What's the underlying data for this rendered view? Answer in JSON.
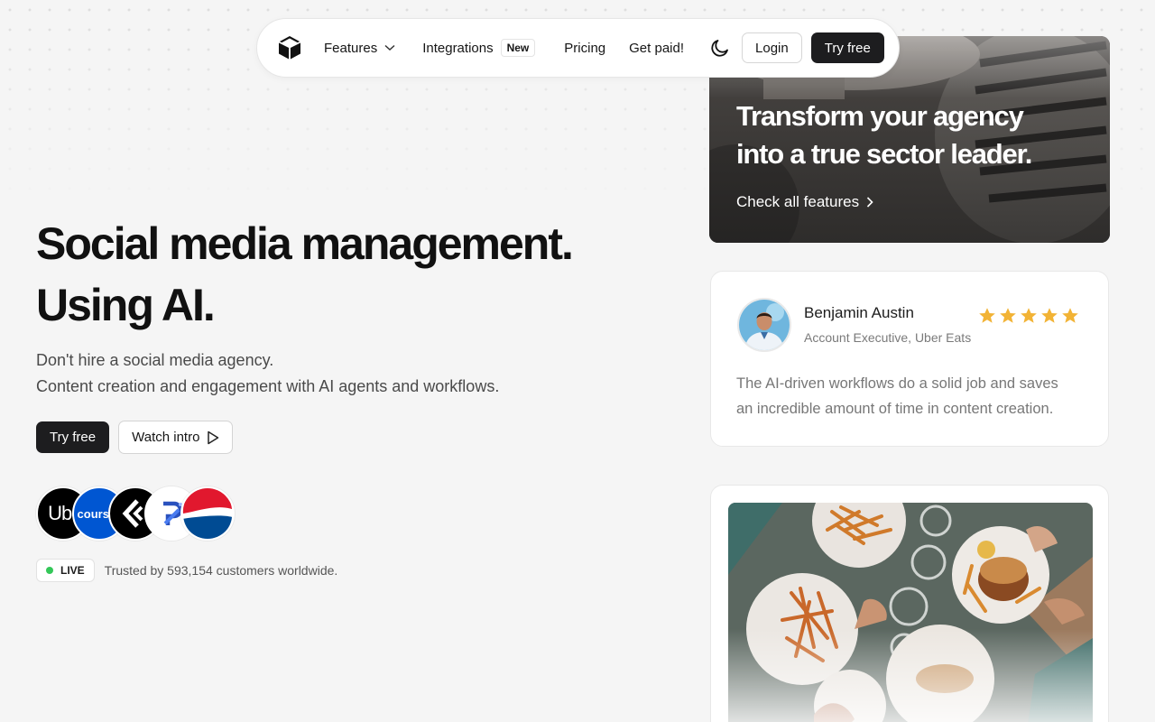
{
  "nav": {
    "logo_icon": "cube-icon",
    "links": [
      {
        "label": "Features",
        "has_dropdown": true
      },
      {
        "label": "Integrations",
        "badge": "New"
      },
      {
        "label": "Pricing"
      },
      {
        "label": "Get paid!"
      }
    ],
    "theme_icon": "moon-icon",
    "login_label": "Login",
    "try_label": "Try free"
  },
  "hero": {
    "title_line1": "Social media management.",
    "title_line2": "Using AI.",
    "sub_line1": "Don't hire a social media agency.",
    "sub_line2": "Content creation and engagement with AI agents and workflows.",
    "cta_primary": "Try free",
    "cta_secondary": "Watch intro",
    "customer_logos": [
      {
        "name": "Uber",
        "text": "Uber",
        "bg": "#000000",
        "fg": "#ffffff"
      },
      {
        "name": "Coursera",
        "text": "coursera",
        "bg": "#0056d2",
        "fg": "#ffffff"
      },
      {
        "name": "Logo 3",
        "text": "",
        "bg": "#000000",
        "fg": "#ffffff"
      },
      {
        "name": "Logo 4",
        "text": "",
        "bg": "#ffffff",
        "fg": "#2a52be"
      },
      {
        "name": "Pepsi",
        "text": "",
        "bg": "#ffffff",
        "fg": "#004b93"
      }
    ],
    "live_label": "LIVE",
    "trusted_text": "Trusted by 593,154 customers worldwide."
  },
  "feature_card": {
    "title_line1": "Transform your agency",
    "title_line2": "into a true sector leader.",
    "link_label": "Check all features"
  },
  "review": {
    "name": "Benjamin Austin",
    "role": "Account Executive, Uber Eats",
    "rating": 5,
    "text_line1": "The AI-driven workflows do a solid job and saves",
    "text_line2": "an incredible amount of time in content creation."
  },
  "colors": {
    "accent_dark": "#1d1d1f",
    "live_green": "#34c759",
    "star": "#f2b335",
    "background": "#f5f5f5"
  }
}
